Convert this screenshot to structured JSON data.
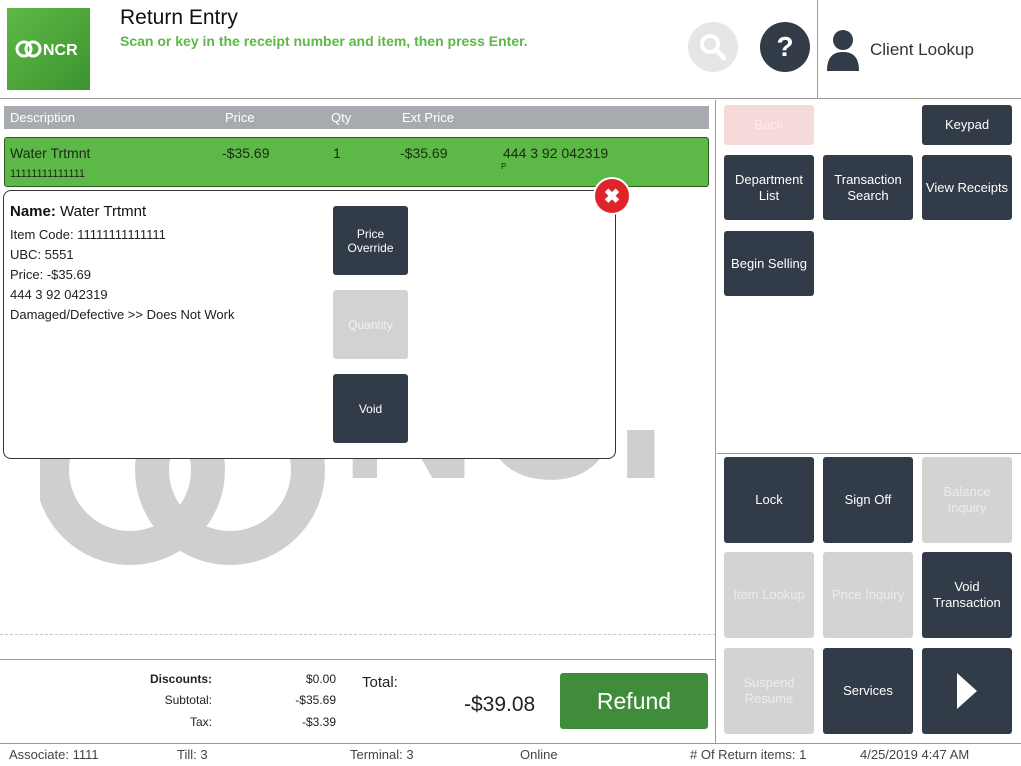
{
  "header": {
    "logo_text": "NCR",
    "title": "Return Entry",
    "subtitle": "Scan or key in the receipt number and item, then press Enter.",
    "help_label": "?",
    "client_lookup_label": "Client Lookup"
  },
  "watermark_text": "NCR",
  "table": {
    "headers": [
      "Description",
      "Price",
      "Qty",
      "Ext Price"
    ],
    "row": {
      "description": "Water Trtmnt",
      "price": "-$35.69",
      "qty": "1",
      "ext_price": "-$35.69",
      "receipt": "444 3 92 042319",
      "item_code": "11111111111111",
      "flag": "P"
    }
  },
  "detail": {
    "name_label": "Name:",
    "name_value": "Water Trtmnt",
    "lines": [
      "Item Code: 11111111111111",
      "UBC: 5551",
      "Price: -$35.69",
      "444 3 92 042319",
      "Damaged/Defective >> Does Not Work"
    ],
    "buttons": {
      "price_override": "Price Override",
      "quantity": "Quantity",
      "void": "Void"
    },
    "close_label": "✖"
  },
  "totals": {
    "discounts_label": "Discounts:",
    "discounts_value": "$0.00",
    "subtotal_label": "Subtotal:",
    "subtotal_value": "-$35.69",
    "tax_label": "Tax:",
    "tax_value": "-$3.39",
    "total_label": "Total:",
    "total_value": "-$39.08",
    "refund_label": "Refund"
  },
  "right_top": {
    "back": "Back",
    "keypad": "Keypad",
    "department_list": "Department List",
    "transaction_search": "Transaction Search",
    "view_receipts": "View Receipts",
    "begin_selling": "Begin Selling"
  },
  "right_bottom": {
    "lock": "Lock",
    "sign_off": "Sign Off",
    "balance_inquiry": "Balance Inquiry",
    "item_lookup": "Item Lookup",
    "price_inquiry": "Price Inquiry",
    "void_transaction": "Void Transaction",
    "suspend_resume": "Suspend Resume",
    "services": "Services",
    "next_arrow": "▶"
  },
  "status_bar": {
    "associate": "Associate: 1111",
    "till": "Till: 3",
    "terminal": "Terminal: 3",
    "connection": "Online",
    "return_items": "# Of Return items: 1",
    "datetime": "4/25/2019 4:47 AM"
  },
  "colors": {
    "brand_green": "#5cb847",
    "dark_button": "#323b48",
    "refund_green": "#3f8c3b",
    "close_red": "#e0242b"
  },
  "icons": [
    "ncr-logo-icon",
    "search-icon",
    "help-icon",
    "user-icon",
    "close-icon",
    "chevron-right-icon"
  ]
}
